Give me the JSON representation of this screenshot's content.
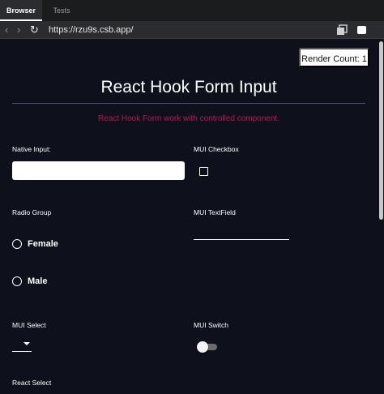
{
  "browser": {
    "tabs": [
      {
        "label": "Browser",
        "active": true
      },
      {
        "label": "Tests",
        "active": false
      }
    ],
    "url": "https://rzu9s.csb.app/"
  },
  "page": {
    "render_count_label": "Render Count: 1",
    "title": "React Hook Form Input",
    "subtitle": "React Hook Form work with controlled component.",
    "subtitle_color": "#bf1650",
    "background_color": "#0e101c",
    "fields": {
      "native_input_label": "Native Input:",
      "native_input_value": "",
      "mui_checkbox_label": "MUI Checkbox",
      "mui_checkbox_checked": false,
      "radio_group_label": "Radio Group",
      "radio_options": [
        "Female",
        "Male"
      ],
      "mui_textfield_label": "MUI TextField",
      "mui_textfield_value": "",
      "mui_select_label": "MUI Select",
      "mui_select_value": "",
      "mui_switch_label": "MUI Switch",
      "mui_switch_on": false,
      "react_select_label": "React Select"
    }
  }
}
